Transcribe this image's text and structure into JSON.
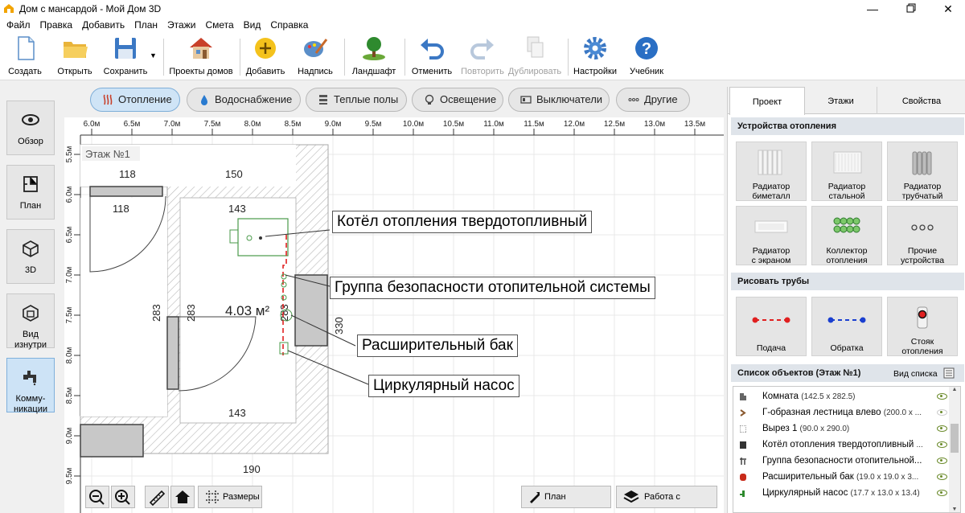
{
  "window": {
    "title": "Дом с мансардой - Мой Дом 3D"
  },
  "menu": [
    "Файл",
    "Правка",
    "Добавить",
    "План",
    "Этажи",
    "Смета",
    "Вид",
    "Справка"
  ],
  "toolbar": {
    "create": "Создать",
    "open": "Открыть",
    "save": "Сохранить",
    "projects": "Проекты домов",
    "add": "Добавить",
    "label": "Надпись",
    "landscape": "Ландшафт",
    "undo": "Отменить",
    "redo": "Повторить",
    "duplicate": "Дублировать",
    "settings": "Настройки",
    "tutorial": "Учебник"
  },
  "left": {
    "overview": "Обзор",
    "plan": "План",
    "view3d": "3D",
    "inside1": "Вид",
    "inside2": "изнутри",
    "comm1": "Комму-",
    "comm2": "никации"
  },
  "filters": [
    "Отопление",
    "Водоснабжение",
    "Теплые полы",
    "Освещение",
    "Выключатели",
    "Другие"
  ],
  "ruler": {
    "top": [
      "6.0м",
      "6.5м",
      "7.0м",
      "7.5м",
      "8.0м",
      "8.5м",
      "9.0м",
      "9.5м",
      "10.0м",
      "10.5м",
      "11.0м",
      "11.5м",
      "12.0м",
      "12.5м",
      "13.0м",
      "13.5м"
    ],
    "left": [
      "5.5м",
      "6.0м",
      "6.5м",
      "7.0м",
      "7.5м",
      "8.0м",
      "8.5м",
      "9.0м",
      "9.5м"
    ]
  },
  "plan": {
    "floor": "Этаж №1",
    "area": "4.03 м²",
    "dims": {
      "d118a": "118",
      "d150": "150",
      "d118b": "118",
      "d143a": "143",
      "d283a": "283",
      "d283b": "283",
      "d283c": "283",
      "d330": "330",
      "d143b": "143",
      "d190": "190"
    }
  },
  "callouts": {
    "boiler": "Котёл отопления твердотопливный",
    "safety": "Группа безопасности отопительной системы",
    "tank": "Расширительный бак",
    "pump": "Циркулярный насос"
  },
  "bottom": {
    "sizes": "Размеры",
    "room_plan": "План помещения",
    "floors_work": "Работа с этажами"
  },
  "panel": {
    "tabs": [
      "Проект",
      "Этажи",
      "Свойства"
    ],
    "heating_title": "Устройства отопления",
    "heating": [
      [
        "Радиатор",
        "биметалл"
      ],
      [
        "Радиатор",
        "стальной"
      ],
      [
        "Радиатор",
        "трубчатый"
      ],
      [
        "Радиатор",
        "с экраном"
      ],
      [
        "Коллектор",
        "отопления"
      ],
      [
        "Прочие",
        "устройства"
      ]
    ],
    "pipes_title": "Рисовать трубы",
    "pipes": [
      [
        "Подача",
        ""
      ],
      [
        "Обратка",
        ""
      ],
      [
        "Стояк",
        "отопления"
      ]
    ],
    "list_title": "Список объектов (Этаж №1)",
    "list_view": "Вид списка",
    "objects": [
      {
        "name": "Комната",
        "size": "(142.5 x 282.5)"
      },
      {
        "name": "Г-образная лестница влево",
        "size": "(200.0 x ..."
      },
      {
        "name": "Вырез 1",
        "size": "(90.0 x 290.0)"
      },
      {
        "name": "Котёл отопления твердотопливный",
        "size": "..."
      },
      {
        "name": "Группа безопасности отопительной...",
        "size": ""
      },
      {
        "name": "Расширительный бак",
        "size": "(19.0 x 19.0 x 3..."
      },
      {
        "name": "Циркулярный насос",
        "size": "(17.7 x 13.0 x 13.4)"
      }
    ]
  },
  "colors": {
    "supply": "#e02020",
    "return": "#1a3fd0",
    "accent": "#2a7bd0",
    "eye": "#6a8a2a"
  }
}
